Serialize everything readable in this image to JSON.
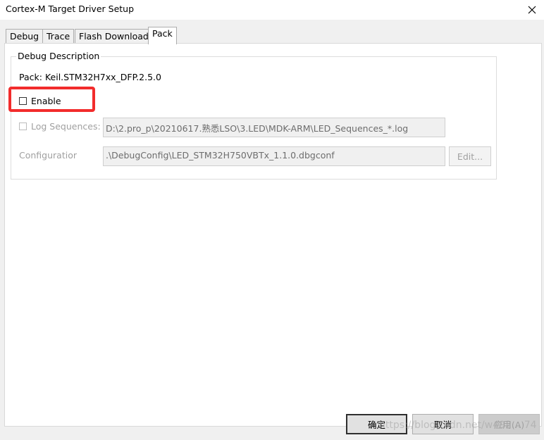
{
  "window": {
    "title": "Cortex-M Target Driver Setup",
    "close_icon": "close-icon"
  },
  "tabs": [
    {
      "label": "Debug"
    },
    {
      "label": "Trace"
    },
    {
      "label": "Flash Download"
    },
    {
      "label": "Pack",
      "active": true
    }
  ],
  "debug_description": {
    "legend": "Debug Description",
    "pack_label": "Pack:",
    "pack_value": "Keil.STM32H7xx_DFP.2.5.0",
    "enable": {
      "label": "Enable",
      "checked": false
    },
    "log_sequences": {
      "label": "Log Sequences:",
      "checked": false,
      "enabled": false,
      "value": "D:\\2.pro_p\\20210617.熟悉LSO\\3.LED\\MDK-ARM\\LED_Sequences_*.log"
    },
    "configuration": {
      "label": "Configuratior",
      "value": ".\\DebugConfig\\LED_STM32H750VBTx_1.1.0.dbgconf",
      "edit_label": "Edit..."
    }
  },
  "buttons": {
    "ok": "确定",
    "cancel": "取消",
    "apply": "应用(A)"
  },
  "watermark": "https://blog.csdn.net/w492... 74",
  "colors": {
    "highlight": "#f22c2c",
    "dialog_bg": "#f0f0f0"
  }
}
